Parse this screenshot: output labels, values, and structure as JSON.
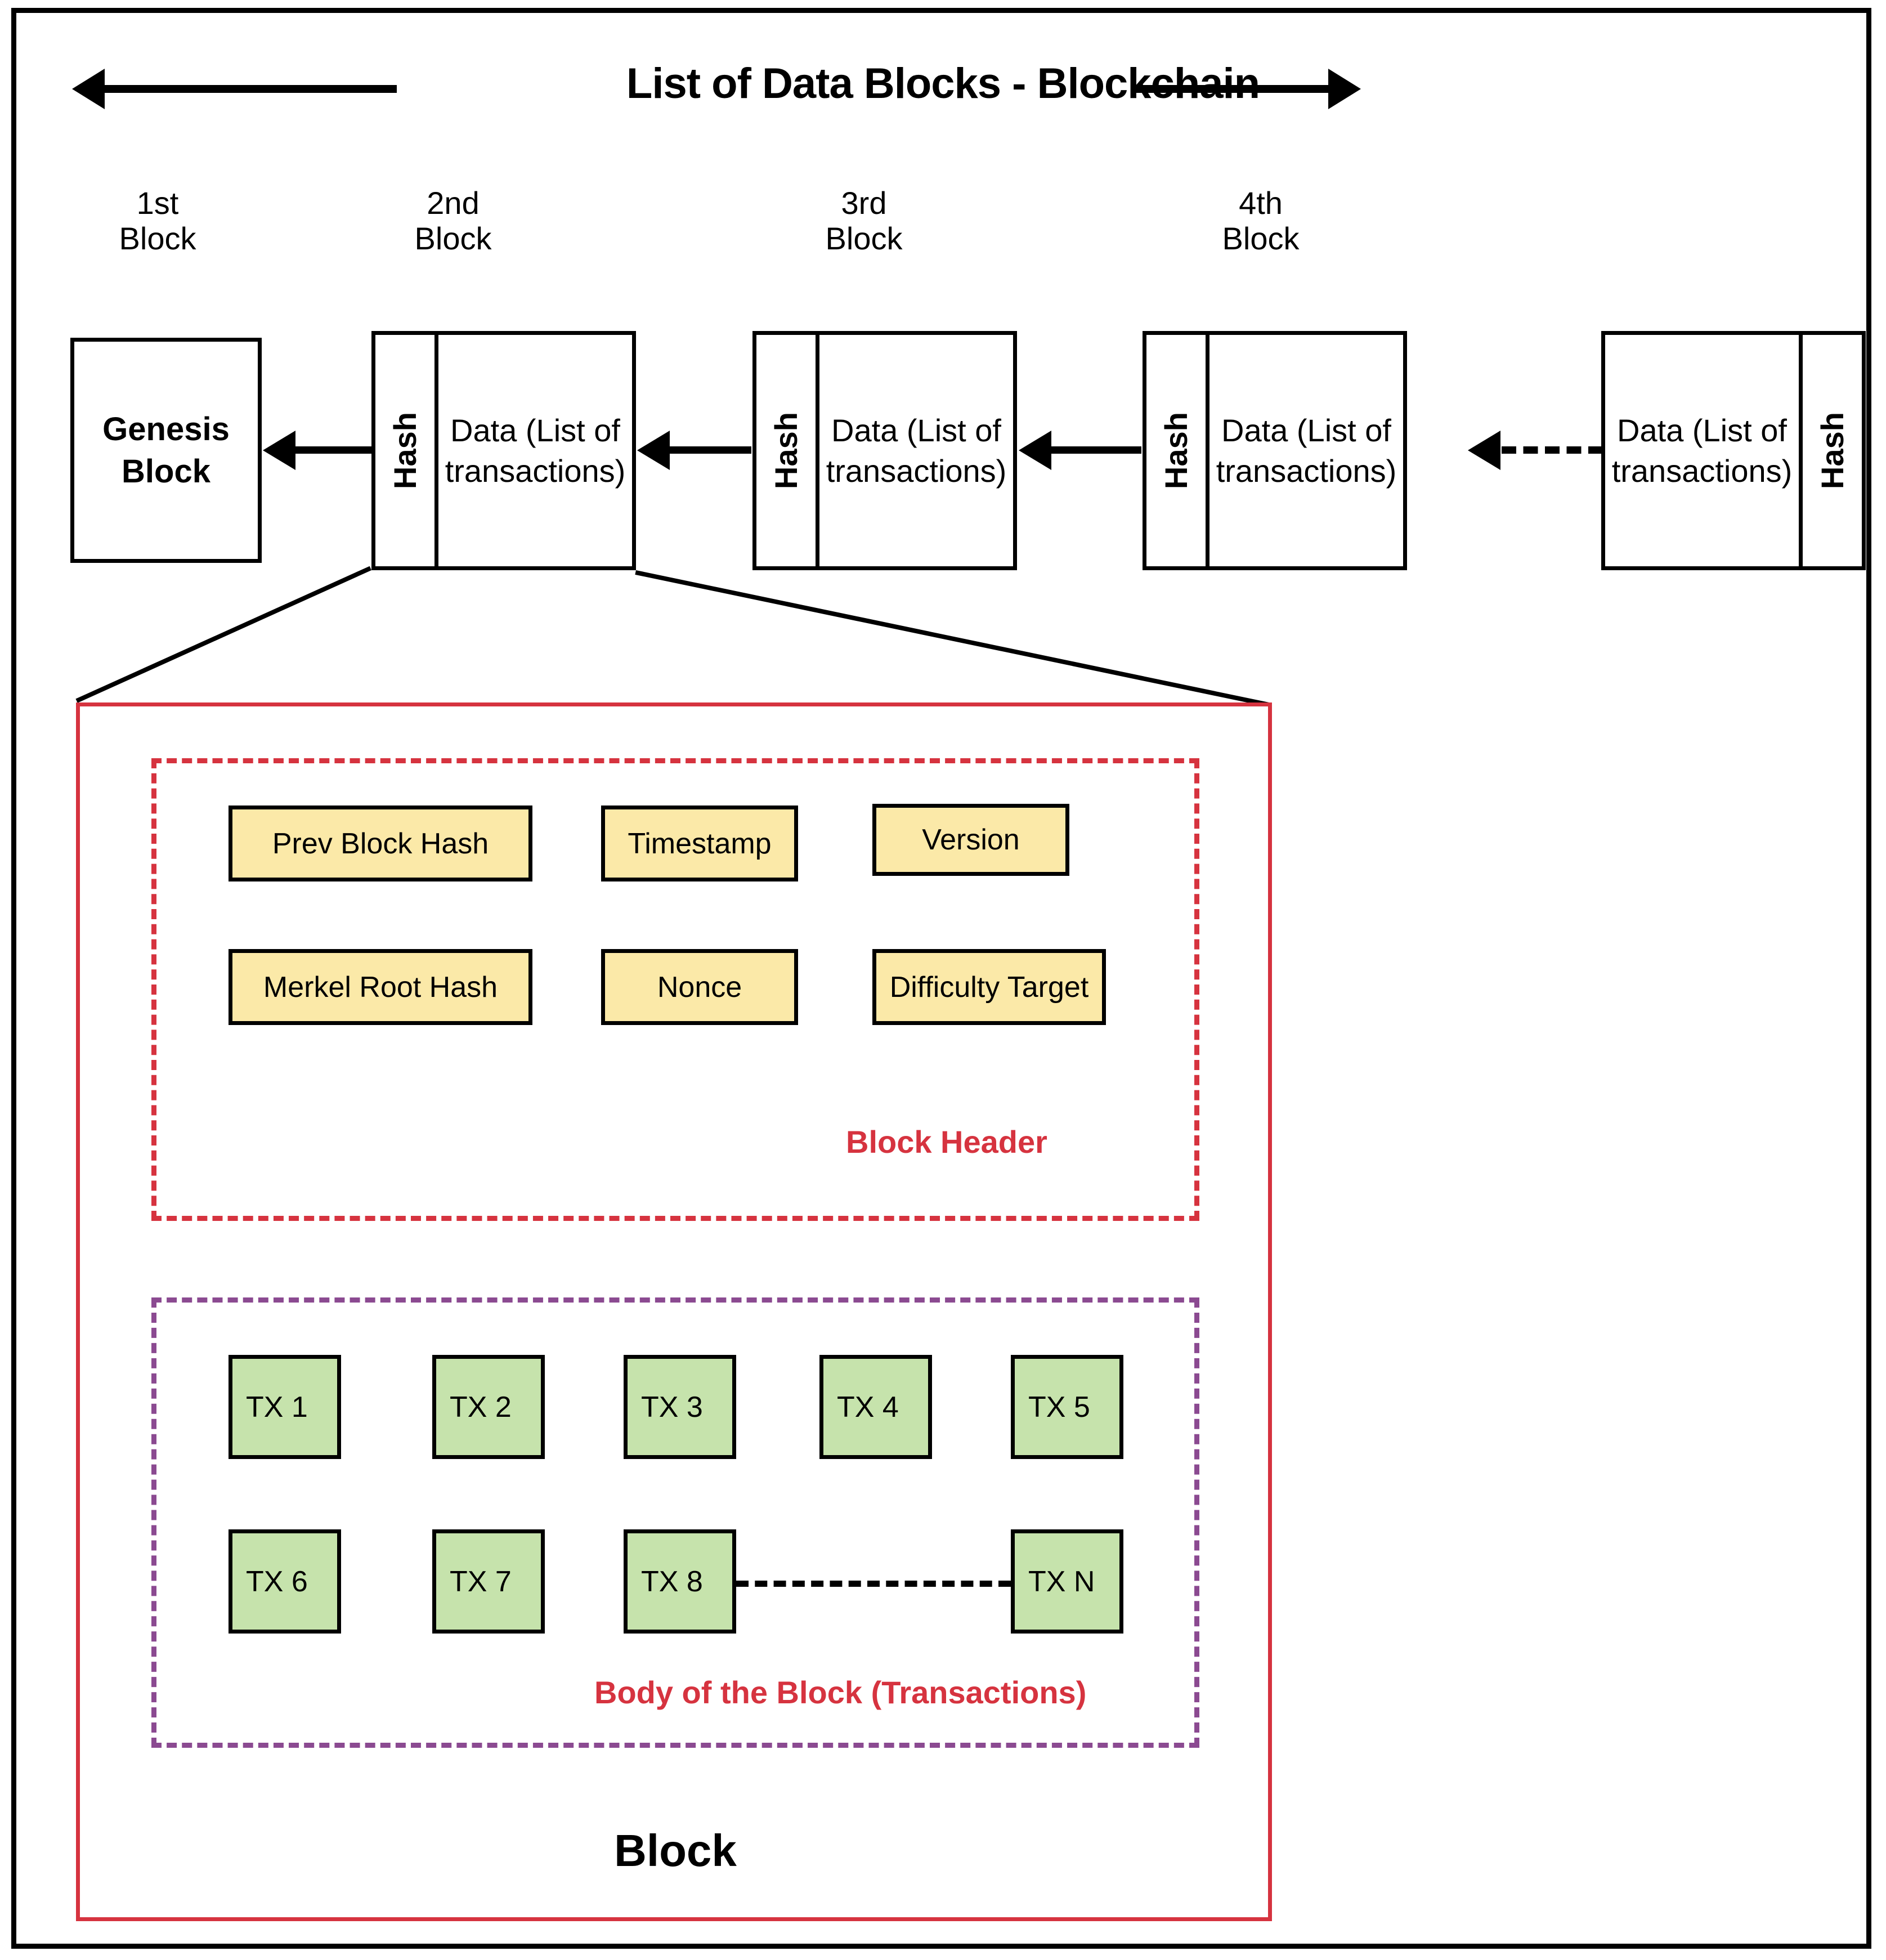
{
  "diagram": {
    "title": "List of Data Blocks - Blockchain",
    "left_arrow_icon": "arrow-left-icon",
    "right_arrow_icon": "arrow-right-icon",
    "colors": {
      "header_border": "#D6333F",
      "body_border": "#8B4A91",
      "block_border": "#D6333F",
      "header_field_fill": "#FBE9A8",
      "transaction_fill": "#C6E3AC",
      "line": "#000000"
    }
  },
  "chain": {
    "ordinals": [
      {
        "ordinal": "1st",
        "noun": "Block"
      },
      {
        "ordinal": "2nd",
        "noun": "Block"
      },
      {
        "ordinal": "3rd",
        "noun": "Block"
      },
      {
        "ordinal": "4th",
        "noun": "Block"
      }
    ],
    "blocks": [
      {
        "kind": "genesis",
        "label": "Genesis Block",
        "hash_label": "",
        "data_label": ""
      },
      {
        "kind": "data",
        "hash_label": "Hash",
        "data_label": "Data (List of transactions)",
        "hash_side": "left"
      },
      {
        "kind": "data",
        "hash_label": "Hash",
        "data_label": "Data (List of transactions)",
        "hash_side": "left"
      },
      {
        "kind": "data",
        "hash_label": "Hash",
        "data_label": "Data (List of transactions)",
        "hash_side": "left"
      },
      {
        "kind": "data",
        "hash_label": "Hash",
        "data_label": "Data (List of transactions)",
        "hash_side": "right"
      }
    ]
  },
  "block_detail": {
    "caption": "Block",
    "header": {
      "label": "Block Header",
      "fields_row1": [
        "Prev Block Hash",
        "Timestamp",
        "Version"
      ],
      "fields_row2": [
        "Merkel Root Hash",
        "Nonce",
        "Difficulty Target"
      ]
    },
    "body": {
      "label": "Body of the Block (Transactions)",
      "transactions_row1": [
        "TX 1",
        "TX 2",
        "TX 3",
        "TX 4",
        "TX 5"
      ],
      "transactions_row2": [
        "TX 6",
        "TX 7",
        "TX 8",
        "TX N"
      ]
    }
  },
  "chart_data": {
    "type": "diagram",
    "title": "List of Data Blocks - Blockchain",
    "structure": "linked list of blocks, each block = Hash cell + Data cell; second block expanded into Block Header and Body regions"
  }
}
